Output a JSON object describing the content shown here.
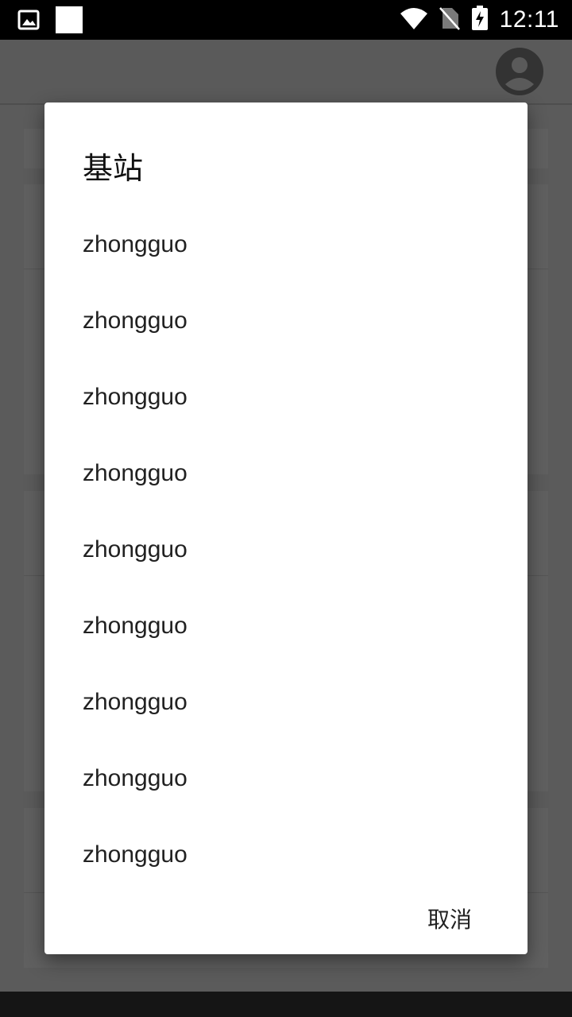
{
  "status_bar": {
    "time": "12:11",
    "icons": [
      "image-icon",
      "white-square-icon",
      "wifi-icon",
      "no-sim-icon",
      "battery-charging-icon"
    ]
  },
  "app_bar": {
    "avatar_icon": "account-circle-icon"
  },
  "dialog": {
    "title": "基站",
    "items": [
      {
        "label": "zhongguo"
      },
      {
        "label": "zhongguo"
      },
      {
        "label": "zhongguo"
      },
      {
        "label": "zhongguo"
      },
      {
        "label": "zhongguo"
      },
      {
        "label": "zhongguo"
      },
      {
        "label": "zhongguo"
      },
      {
        "label": "zhongguo"
      },
      {
        "label": "zhongguo"
      }
    ],
    "cancel_label": "取消"
  },
  "colors": {
    "scrim": "#5b5b5b",
    "status_bar": "#000000",
    "dialog_bg": "#ffffff",
    "text_primary": "#212121"
  }
}
